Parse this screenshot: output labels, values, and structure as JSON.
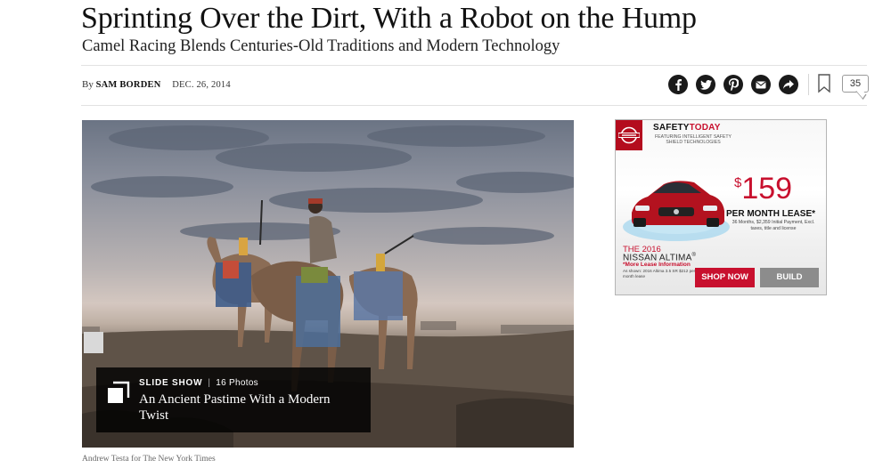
{
  "article": {
    "headline": "Sprinting Over the Dirt, With a Robot on the Hump",
    "summary": "Camel Racing Blends Centuries-Old Traditions and Modern Technology",
    "byline_prefix": "By",
    "author": "SAM BORDEN",
    "date": "DEC. 26, 2014"
  },
  "share": {
    "icons": [
      "facebook-icon",
      "twitter-icon",
      "pinterest-icon",
      "email-icon",
      "more-share-icon"
    ],
    "bookmark_icon": "bookmark-icon",
    "comments_count": "35"
  },
  "media": {
    "slideshow_label": "SLIDE SHOW",
    "separator": "|",
    "photo_count": "16 Photos",
    "slideshow_title": "An Ancient Pastime With a Modern Twist",
    "credit": "Andrew Testa for The New York Times"
  },
  "ad": {
    "brand_logo": "nissan-logo",
    "safety": "SAFETY",
    "today": "TODAY",
    "featuring": "FEATURING INTELLIGENT SAFETY SHIELD TECHNOLOGIES",
    "dollar": "$",
    "price": "159",
    "lease_label": "PER MONTH LEASE*",
    "terms": "36 Months, $2,359 Initial Payment, Excl. taxes, title and license",
    "year": "THE 2016",
    "model": "NISSAN ALTIMA",
    "model_mark": "®",
    "more_info": "*More Lease Information",
    "shown": "As shown: 2016 Altima 3.5 SR $212 per month lease",
    "shop_label": "SHOP NOW",
    "build_label": "BUILD",
    "accent": "#c8102e"
  }
}
